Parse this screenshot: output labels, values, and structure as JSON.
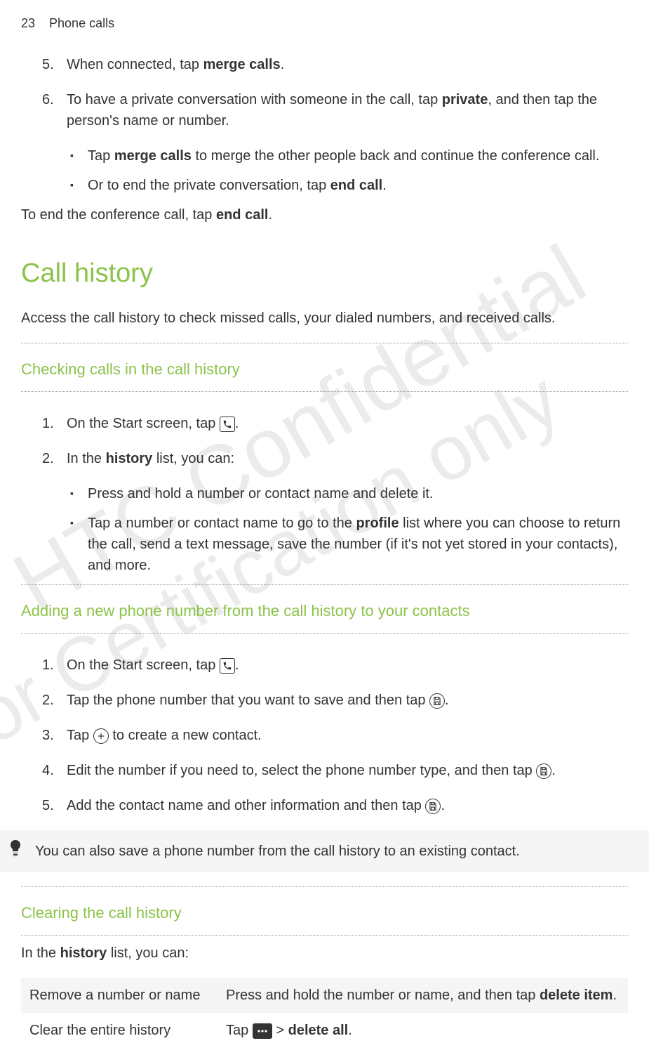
{
  "header": {
    "page_number": "23",
    "section": "Phone calls"
  },
  "watermarks": {
    "wm1": "HTC Confidential",
    "wm2": "for Certification only"
  },
  "steps_top": [
    {
      "num": "5.",
      "pre": "When connected, tap ",
      "bold": "merge calls",
      "post": "."
    },
    {
      "num": "6.",
      "pre": "To have a private conversation with someone in the call, tap ",
      "bold": "private",
      "post": ", and then tap the person's name or number."
    }
  ],
  "bullets_top": [
    {
      "pre": "Tap ",
      "bold": "merge calls",
      "post": " to merge the other people back and continue the conference call."
    },
    {
      "pre": "Or to end the private conversation, tap ",
      "bold": "end call",
      "post": "."
    }
  ],
  "para_end_conf": {
    "pre": "To end the conference call, tap ",
    "bold": "end call",
    "post": "."
  },
  "section_title": "Call history",
  "section_intro": "Access the call history to check missed calls, your dialed numbers, and received calls.",
  "sub1": {
    "title": "Checking calls in the call history",
    "steps": [
      {
        "num": "1.",
        "pre": "On the Start screen, tap ",
        "icon": "phone",
        "post": "."
      },
      {
        "num": "2.",
        "pre": "In the ",
        "bold": "history",
        "post": " list, you can:"
      }
    ],
    "bullets": [
      {
        "text": "Press and hold a number or contact name and delete it."
      },
      {
        "pre": "Tap a number or contact name to go to the ",
        "bold": "profile",
        "post": " list where you can choose to return the call, send a text message, save the number (if it's not yet stored in your contacts), and more."
      }
    ]
  },
  "sub2": {
    "title": "Adding a new phone number from the call history to your contacts",
    "steps": [
      {
        "num": "1.",
        "pre": "On the Start screen, tap ",
        "icon": "phone",
        "post": "."
      },
      {
        "num": "2.",
        "pre": "Tap the phone number that you want to save and then tap ",
        "icon": "save",
        "post": "."
      },
      {
        "num": "3.",
        "pre": "Tap ",
        "icon": "add",
        "post": " to create a new contact."
      },
      {
        "num": "4.",
        "pre": "Edit the number if you need to, select the phone number type, and then tap ",
        "icon": "save",
        "post": "."
      },
      {
        "num": "5.",
        "pre": "Add the contact name and other information and then tap ",
        "icon": "save",
        "post": "."
      }
    ],
    "tip": "You can also save a phone number from the call history to an existing contact."
  },
  "sub3": {
    "title": "Clearing the call history",
    "intro": {
      "pre": "In the ",
      "bold": "history",
      "post": " list, you can:"
    },
    "table": [
      {
        "left": "Remove a number or name",
        "right_pre": "Press and hold the number or name, and then tap ",
        "right_bold": "delete item",
        "right_post": "."
      },
      {
        "left": "Clear the entire history",
        "right_pre": "Tap ",
        "right_icon": "dots",
        "right_mid": " > ",
        "right_bold": "delete all",
        "right_post": "."
      }
    ]
  }
}
